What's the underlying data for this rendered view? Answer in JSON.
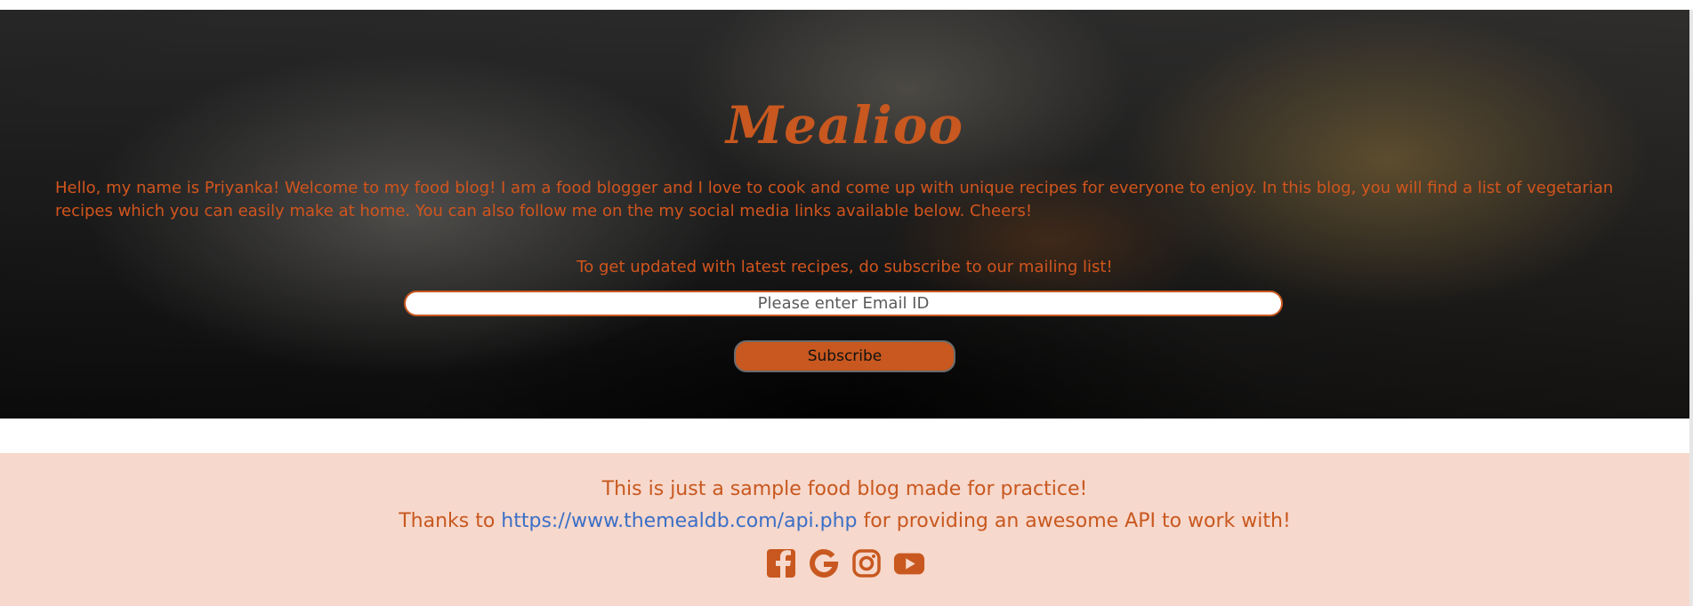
{
  "hero": {
    "brand": "Mealioo",
    "intro": "Hello, my name is Priyanka! Welcome to my food blog! I am a food blogger and I love to cook and come up with unique recipes for everyone to enjoy. In this blog, you will find a list of vegetarian recipes which you can easily make at home. You can also follow me on the my social media links available below. Cheers!",
    "subscribe_prompt": "To get updated with latest recipes, do subscribe to our mailing list!",
    "email_placeholder": "Please enter Email ID",
    "subscribe_label": "Subscribe"
  },
  "footer": {
    "line1": "This is just a sample food blog made for practice!",
    "thanks_prefix": "Thanks to",
    "api_link": "https://www.themealdb.com/api.php",
    "thanks_suffix": "for providing an awesome API to work with!",
    "socials": [
      "facebook-icon",
      "google-icon",
      "instagram-icon",
      "youtube-icon"
    ]
  },
  "colors": {
    "accent": "#c8581f",
    "text_orange": "#d2551d",
    "footer_bg": "#f7d8cc",
    "link": "#3b6fc6"
  }
}
